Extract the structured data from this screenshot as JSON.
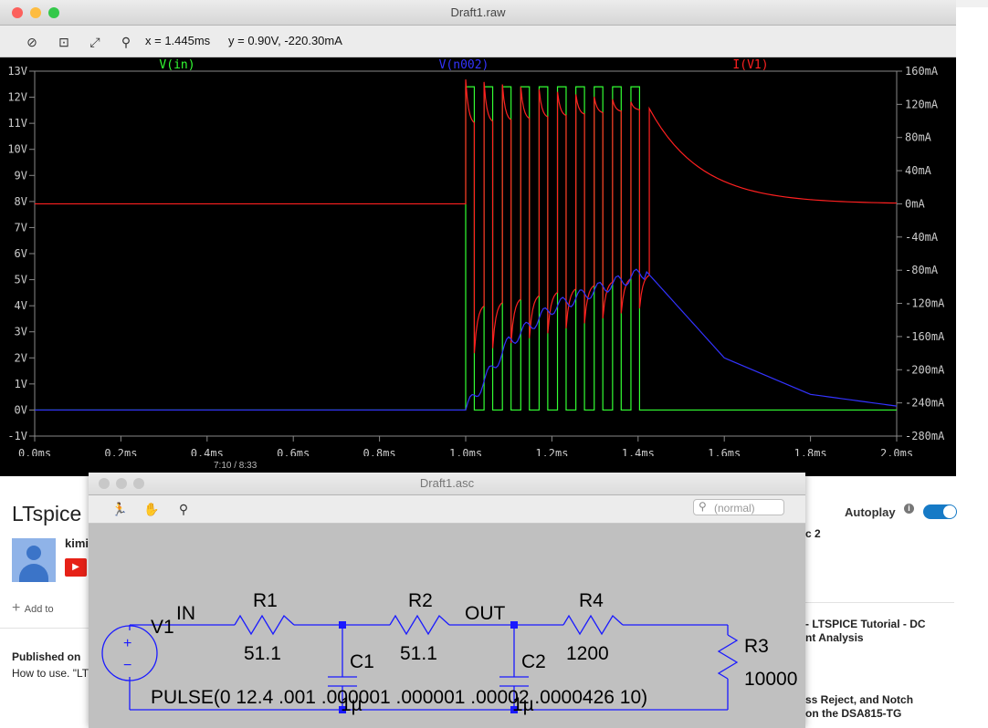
{
  "plot": {
    "title": "Draft1.raw",
    "readout_x": "x = 1.445ms",
    "readout_y": "y = 0.90V, -220.30mA",
    "traces": {
      "vin": "V(in)",
      "vn002": "V(n002)",
      "iv1": "I(V1)"
    },
    "trace_colors": {
      "vin": "#33ff33",
      "vn002": "#3333ff",
      "iv1": "#ff2020"
    },
    "left_ticks": [
      "13V",
      "12V",
      "11V",
      "10V",
      "9V",
      "8V",
      "7V",
      "6V",
      "5V",
      "4V",
      "3V",
      "2V",
      "1V",
      "0V",
      "-1V"
    ],
    "right_ticks": [
      "160mA",
      "120mA",
      "80mA",
      "40mA",
      "0mA",
      "-40mA",
      "-80mA",
      "-120mA",
      "-160mA",
      "-200mA",
      "-240mA",
      "-280mA"
    ],
    "x_ticks": [
      "0.0ms",
      "0.2ms",
      "0.4ms",
      "0.6ms",
      "0.8ms",
      "1.0ms",
      "1.2ms",
      "1.4ms",
      "1.6ms",
      "1.8ms",
      "2.0ms"
    ]
  },
  "video": {
    "time": "7:10 / 8:33"
  },
  "schematic": {
    "title": "Draft1.asc",
    "search_placeholder": "(normal)",
    "labels": {
      "v1": "V1",
      "in": "IN",
      "out": "OUT",
      "r1": "R1",
      "r1_val": "51.1",
      "r2": "R2",
      "r2_val": "51.1",
      "r4": "R4",
      "r4_val": "1200",
      "r3": "R3",
      "r3_val": "10000",
      "c1": "C1",
      "c2": "C2",
      "cap_val": "1µ",
      "pulse": "PULSE(0 12.4 .001 .000001 .000001 .00002 .0000426 10)"
    }
  },
  "youtube": {
    "title": "LTspice",
    "channel": "kimi",
    "add_to": "Add to",
    "published": "Published on",
    "desc": "How to use. \"LT",
    "autoplay": "Autoplay",
    "side1": "c 2",
    "side2a": "- LTSPICE Tutorial - DC",
    "side2b": "nt Analysis",
    "side3a": "ss Reject, and Notch",
    "side3b": "on the DSA815-TG"
  },
  "chart_data": {
    "type": "line",
    "x_unit": "ms",
    "xlim": [
      0,
      2.0
    ],
    "ylim_left": [
      -1,
      13
    ],
    "ylim_right": [
      -280,
      160
    ],
    "series": [
      {
        "name": "V(in)",
        "axis": "left",
        "description_points": {
          "pulse_high": 12.4,
          "pulse_low": 0,
          "start_ms": 1.0,
          "period_ms": 0.0426,
          "count": 10
        }
      },
      {
        "name": "V(n002)",
        "axis": "left",
        "x": [
          0,
          1.0,
          1.1,
          1.2,
          1.3,
          1.42,
          1.6,
          1.8,
          2.0
        ],
        "y": [
          0,
          0,
          2.6,
          3.9,
          4.6,
          5.3,
          2.0,
          0.6,
          0.15
        ]
      },
      {
        "name": "I(V1)",
        "axis": "right",
        "x": [
          0,
          1.0,
          1.42,
          1.6,
          1.8,
          2.0
        ],
        "y": [
          0,
          0,
          115,
          20,
          4,
          0
        ]
      }
    ]
  }
}
